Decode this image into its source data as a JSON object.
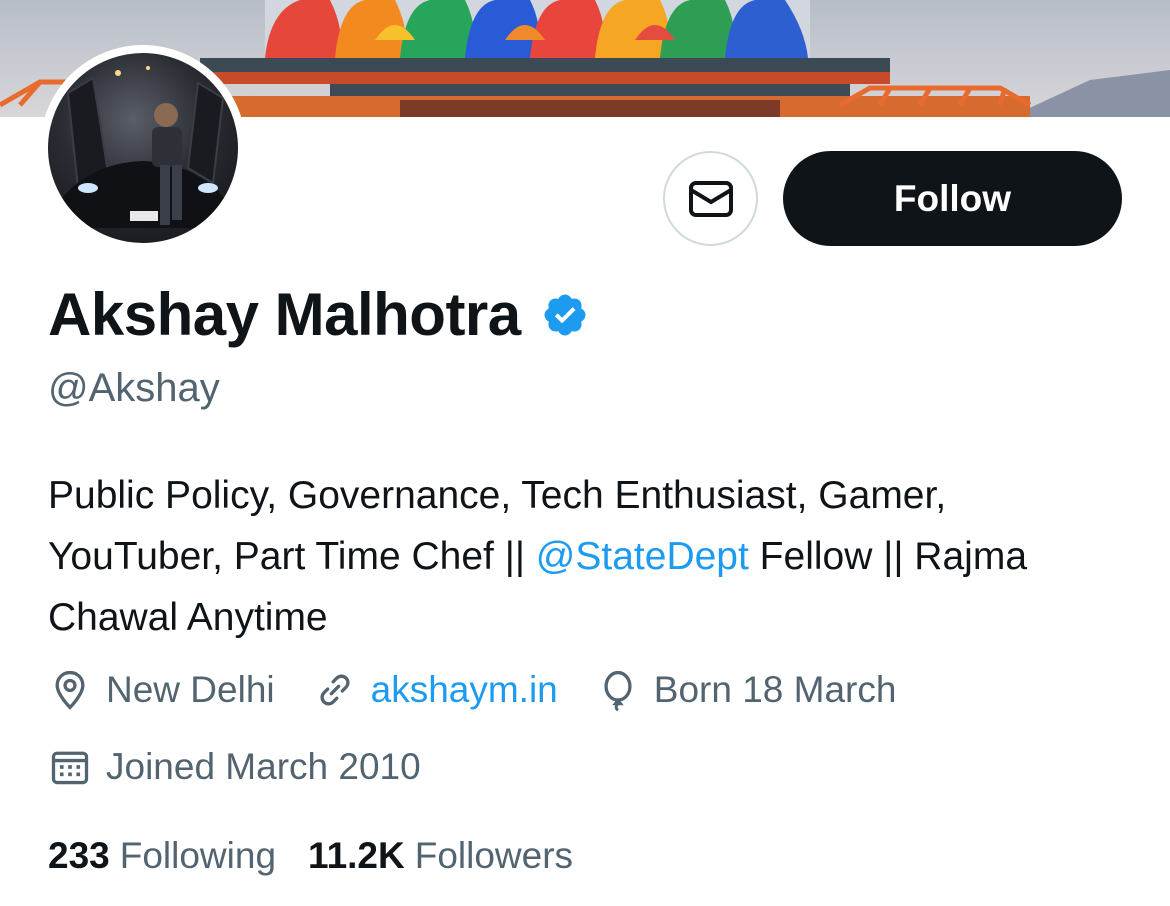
{
  "profile": {
    "name": "Akshay Malhotra",
    "handle": "@Akshay",
    "verified": true,
    "bio_parts": {
      "before_mention": "Public Policy, Governance, Tech Enthusiast, Gamer, YouTuber, Part Time Chef || ",
      "mention": "@StateDept",
      "after_mention": " Fellow || Rajma Chawal Anytime"
    },
    "location": "New Delhi",
    "website": "akshaym.in",
    "birthday": "Born 18 March",
    "joined": "Joined March 2010"
  },
  "actions": {
    "message_icon": "envelope-icon",
    "follow_label": "Follow"
  },
  "stats": {
    "following_count": "233",
    "following_label": "Following",
    "followers_count": "11.2K",
    "followers_label": "Followers"
  },
  "icons": {
    "location": "location-pin-icon",
    "website": "link-icon",
    "birthday": "balloon-icon",
    "joined": "calendar-icon",
    "verified": "verified-badge-icon"
  },
  "colors": {
    "accent": "#1d9bf0",
    "text_primary": "#0f1419",
    "text_secondary": "#536471",
    "follow_button": "#0f1419",
    "border": "#cfd9de"
  }
}
